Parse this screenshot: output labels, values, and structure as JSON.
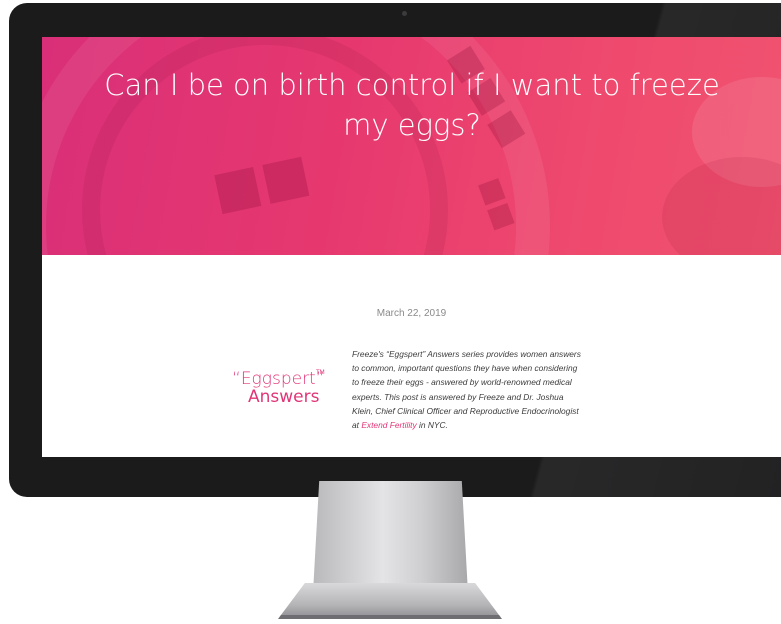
{
  "article": {
    "title": "Can I be on birth control if I want to freeze my eggs?",
    "date": "March 22, 2019"
  },
  "logo": {
    "open_quote": "“",
    "word1": "Eggspert",
    "close_quote": "”",
    "trademark": "TM",
    "word2": "Answers"
  },
  "intro": {
    "text_before_link": "Freeze's “Eggspert” Answers series provides women answers to common, important questions they have when considering to freeze their eggs - answered by world-renowned medical experts. This post is answered by Freeze and Dr. Joshua Klein, Chief Clinical Officer and Reproductive Endocrinologist at ",
    "link_text": "Extend Fertility",
    "text_after_link": " in NYC."
  },
  "colors": {
    "hero_pink": "#e6386f",
    "accent_pink": "#e13577",
    "bezel": "#1b1b1c"
  },
  "icons": [
    "camera-dot"
  ]
}
